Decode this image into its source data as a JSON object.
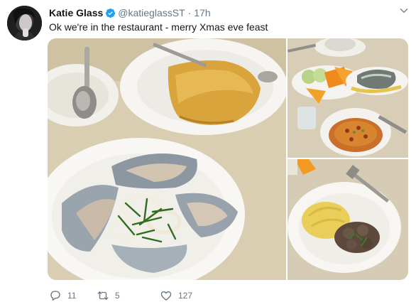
{
  "tweet": {
    "author_name": "Katie Glass",
    "author_handle": "@katieglassST",
    "separator": "·",
    "time": "17h",
    "text": "Ok we're in the restaurant - merry Xmas eve feast"
  },
  "actions": {
    "reply_count": "11",
    "retweet_count": "5",
    "like_count": "127"
  },
  "colors": {
    "verified": "#1da1f2",
    "secondary_text": "#657786"
  },
  "icons": [
    "verified-badge-icon",
    "chevron-down-icon",
    "reply-icon",
    "retweet-icon",
    "like-icon"
  ]
}
